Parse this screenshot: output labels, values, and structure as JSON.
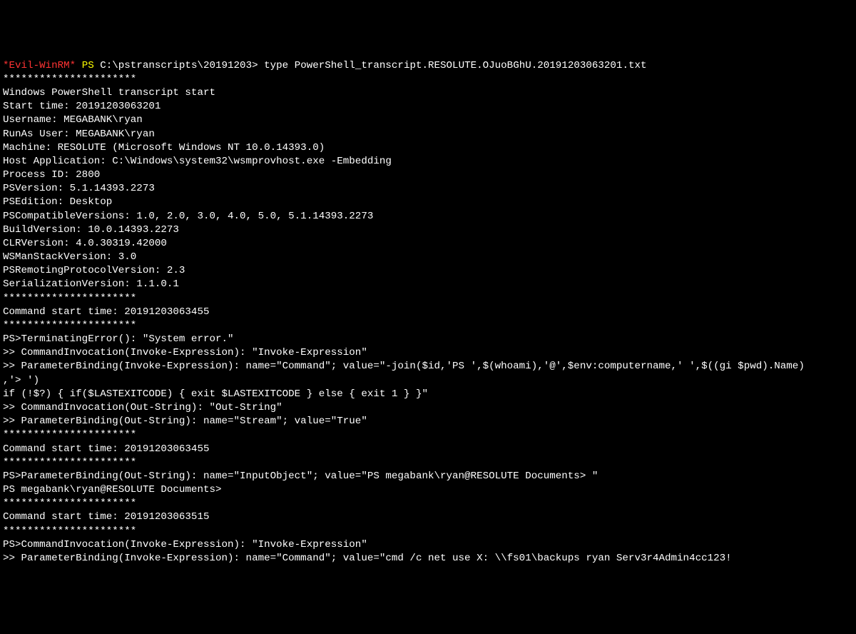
{
  "prompt": {
    "evil_winrm": "*Evil-WinRM*",
    "ps": "PS",
    "path": "C:\\pstranscripts\\20191203>",
    "command": "type PowerShell_transcript.RESOLUTE.OJuoBGhU.20191203063201.txt"
  },
  "lines": {
    "l0": "**********************",
    "l1": "Windows PowerShell transcript start",
    "l2": "Start time: 20191203063201",
    "l3": "Username: MEGABANK\\ryan",
    "l4": "RunAs User: MEGABANK\\ryan",
    "l5": "Machine: RESOLUTE (Microsoft Windows NT 10.0.14393.0)",
    "l6": "Host Application: C:\\Windows\\system32\\wsmprovhost.exe -Embedding",
    "l7": "Process ID: 2800",
    "l8": "PSVersion: 5.1.14393.2273",
    "l9": "PSEdition: Desktop",
    "l10": "PSCompatibleVersions: 1.0, 2.0, 3.0, 4.0, 5.0, 5.1.14393.2273",
    "l11": "BuildVersion: 10.0.14393.2273",
    "l12": "CLRVersion: 4.0.30319.42000",
    "l13": "WSManStackVersion: 3.0",
    "l14": "PSRemotingProtocolVersion: 2.3",
    "l15": "SerializationVersion: 1.1.0.1",
    "l16": "**********************",
    "l17": "Command start time: 20191203063455",
    "l18": "**********************",
    "l19": "PS>TerminatingError(): \"System error.\"",
    "l20": ">> CommandInvocation(Invoke-Expression): \"Invoke-Expression\"",
    "l21": ">> ParameterBinding(Invoke-Expression): name=\"Command\"; value=\"-join($id,'PS ',$(whoami),'@',$env:computername,' ',$((gi $pwd).Name)",
    "l22": ",'> ')",
    "l23": "if (!$?) { if($LASTEXITCODE) { exit $LASTEXITCODE } else { exit 1 } }\"",
    "l24": ">> CommandInvocation(Out-String): \"Out-String\"",
    "l25": ">> ParameterBinding(Out-String): name=\"Stream\"; value=\"True\"",
    "l26": "**********************",
    "l27": "Command start time: 20191203063455",
    "l28": "**********************",
    "l29": "PS>ParameterBinding(Out-String): name=\"InputObject\"; value=\"PS megabank\\ryan@RESOLUTE Documents> \"",
    "l30": "PS megabank\\ryan@RESOLUTE Documents>",
    "l31": "**********************",
    "l32": "Command start time: 20191203063515",
    "l33": "**********************",
    "l34": "PS>CommandInvocation(Invoke-Expression): \"Invoke-Expression\"",
    "l35": ">> ParameterBinding(Invoke-Expression): name=\"Command\"; value=\"cmd /c net use X: \\\\fs01\\backups ryan Serv3r4Admin4cc123!"
  }
}
